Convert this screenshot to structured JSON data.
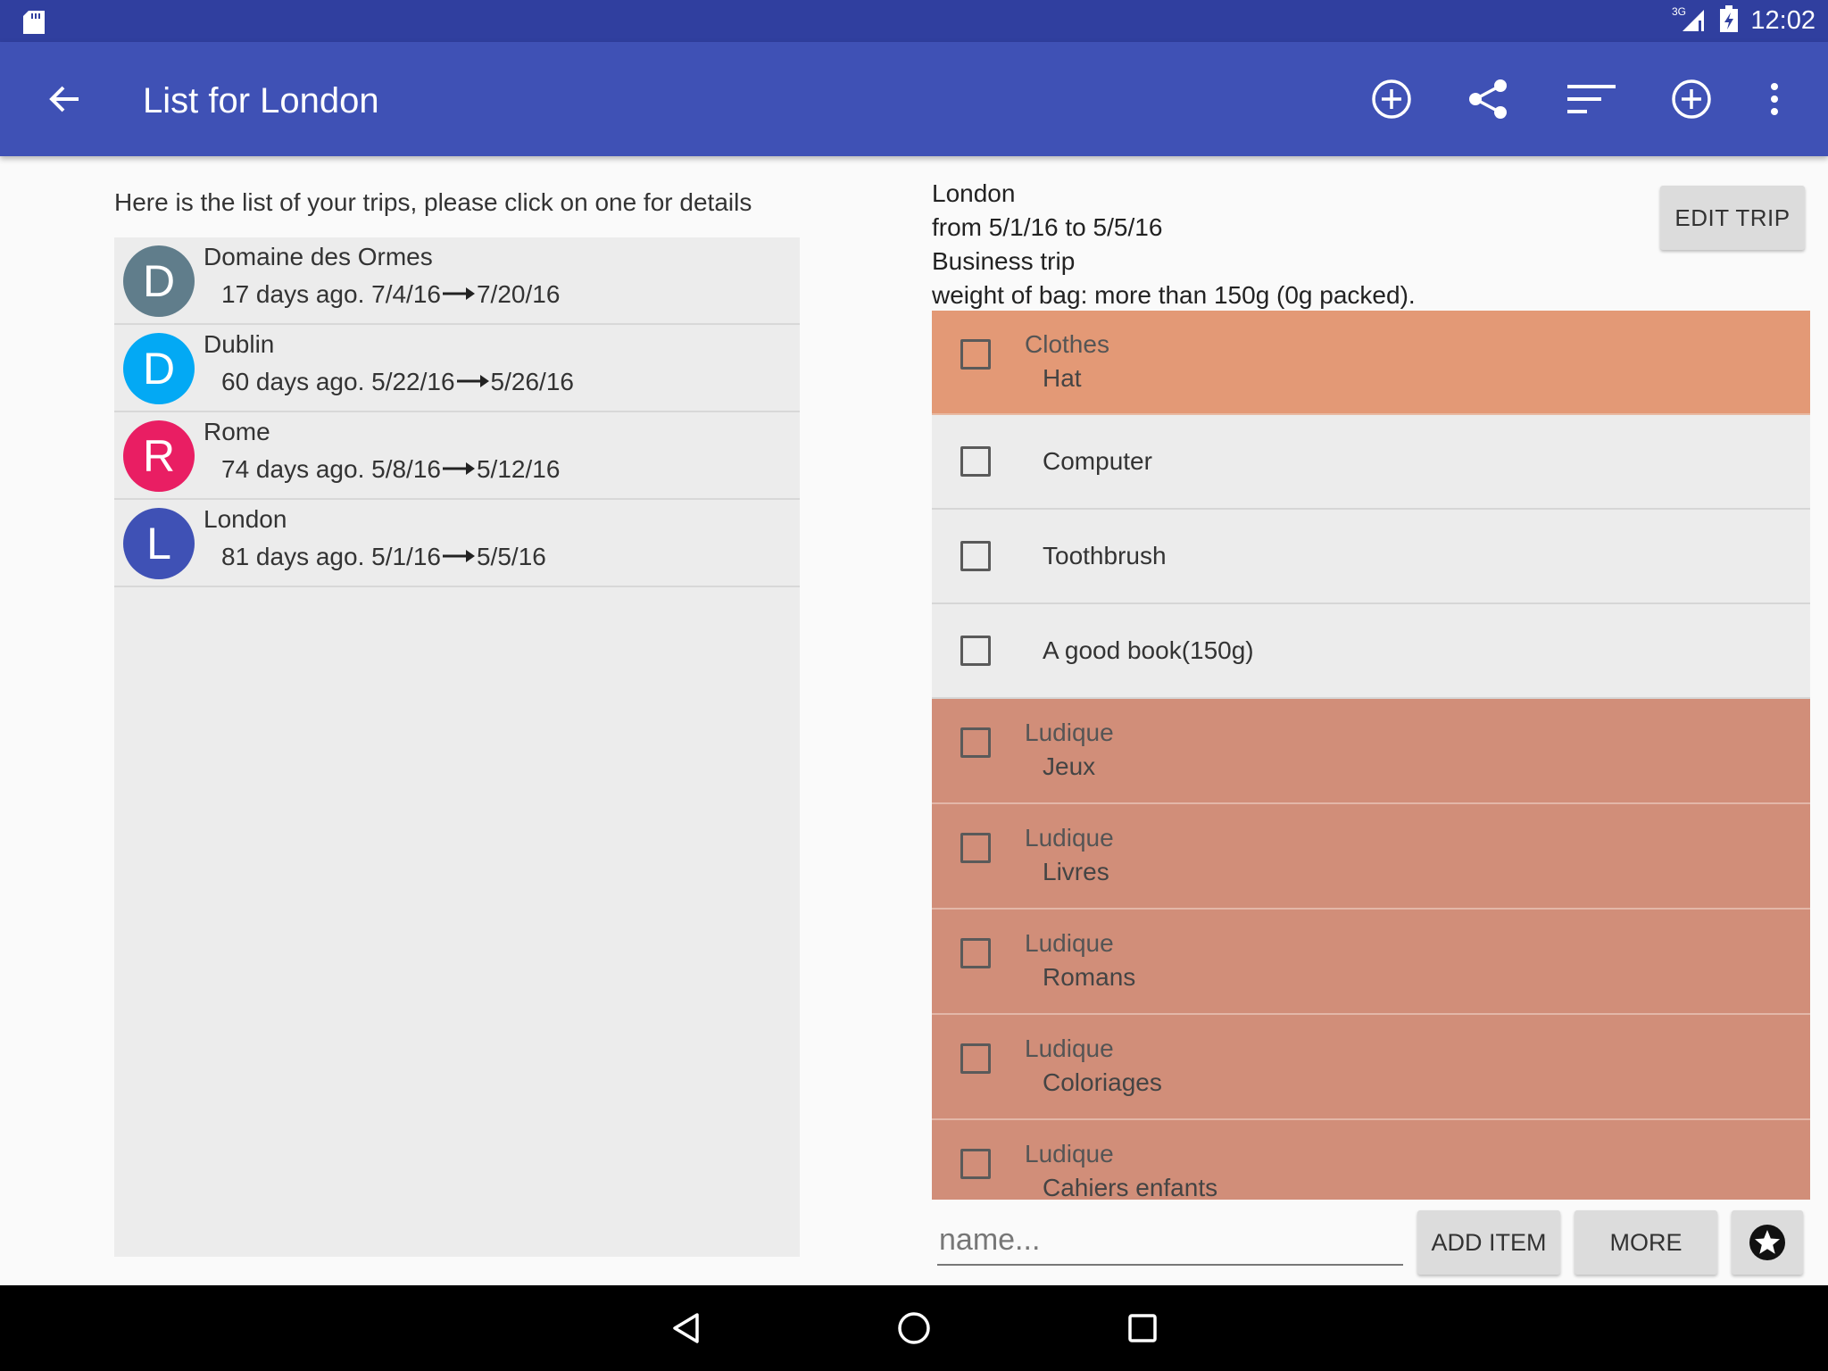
{
  "status_bar": {
    "time": "12:02",
    "network": "3G"
  },
  "app_bar": {
    "title": "List for London"
  },
  "trips_panel": {
    "intro": "Here is the list of your trips, please click on one for details",
    "trips": [
      {
        "initial": "D",
        "name": "Domaine des Ormes",
        "ago": "17 days ago.",
        "from": "7/4/16",
        "to": "7/20/16",
        "color": "#607d8b"
      },
      {
        "initial": "D",
        "name": "Dublin",
        "ago": "60 days ago.",
        "from": "5/22/16",
        "to": "5/26/16",
        "color": "#03a9f4"
      },
      {
        "initial": "R",
        "name": "Rome",
        "ago": "74 days ago.",
        "from": "5/8/16",
        "to": "5/12/16",
        "color": "#e91e63"
      },
      {
        "initial": "L",
        "name": "London",
        "ago": "81 days ago.",
        "from": "5/1/16",
        "to": "5/5/16",
        "color": "#3f51b5"
      }
    ]
  },
  "detail": {
    "city": "London",
    "dates": "from 5/1/16 to 5/5/16",
    "type": "Business trip",
    "weight": "weight of bag: more than 150g (0g packed).",
    "edit_label": "EDIT TRIP"
  },
  "items": [
    {
      "category": "Clothes",
      "name": "Hat",
      "style": "cat-orange"
    },
    {
      "category": "",
      "name": "Computer",
      "style": "single"
    },
    {
      "category": "",
      "name": "Toothbrush",
      "style": "single"
    },
    {
      "category": "",
      "name": "A good book(150g)",
      "style": "single"
    },
    {
      "category": "Ludique",
      "name": "Jeux",
      "style": "cat-salmon"
    },
    {
      "category": "Ludique",
      "name": "Livres",
      "style": "cat-salmon"
    },
    {
      "category": "Ludique",
      "name": "Romans",
      "style": "cat-salmon"
    },
    {
      "category": "Ludique",
      "name": "Coloriages",
      "style": "cat-salmon"
    },
    {
      "category": "Ludique",
      "name": "Cahiers enfants",
      "style": "cat-salmon"
    }
  ],
  "input_row": {
    "placeholder": "name...",
    "add_label": "ADD ITEM",
    "more_label": "MORE"
  },
  "colors": {
    "primary": "#3f51b5",
    "primary_dark": "#303f9f",
    "clothes": "#e39976",
    "ludique": "#d18e79"
  }
}
